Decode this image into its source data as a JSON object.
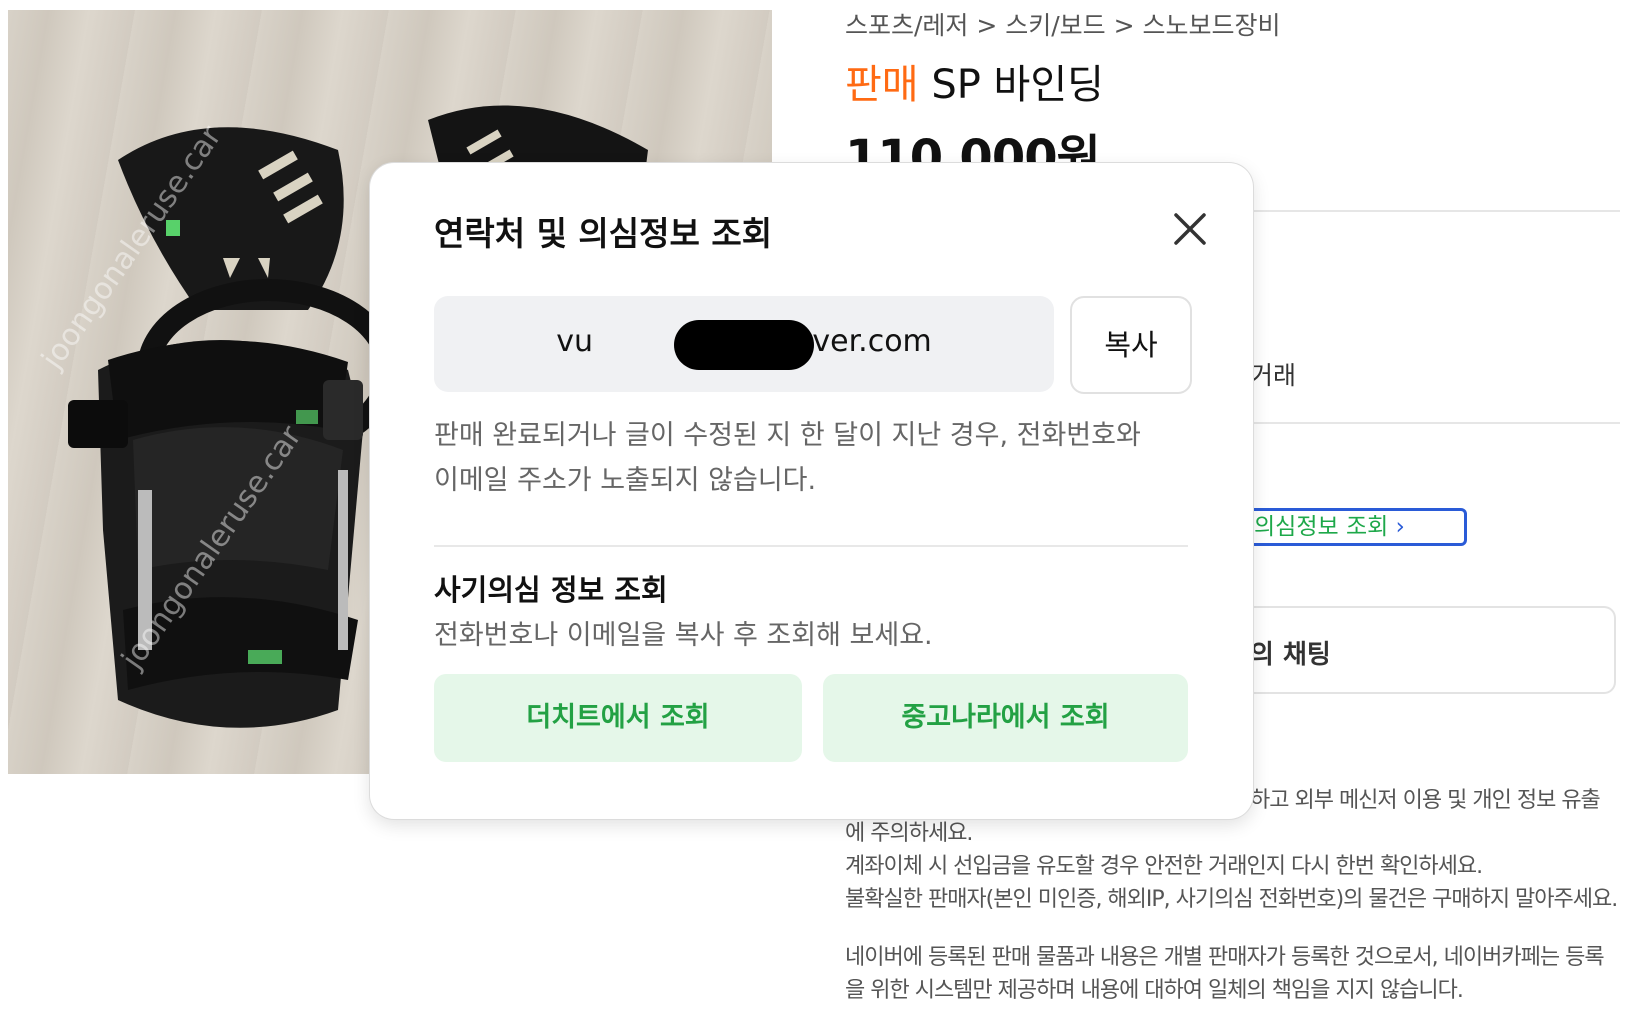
{
  "product": {
    "breadcrumb": "스포츠/레저 > 스키/보드 > 스노보드장비",
    "sale_label": "판매",
    "name": "SP 바인딩",
    "price": "110,000원",
    "trade_text": "거래",
    "fraud_link_label": "의심정보 조회",
    "chat_label": "의 채팅",
    "watermark": "joongonaleruse.car",
    "notices": [
      "하고 외부 메신저 이용 및 개인 정보 유출",
      "에 주의하세요.",
      "계좌이체 시 선입금을 유도할 경우 안전한 거래인지 다시 한번 확인하세요.",
      "불확실한 판매자(본인 미인증, 해외IP, 사기의심 전화번호)의 물건은 구매하지 말아주세요.",
      "네이버에 등록된 판매 물품과 내용은 개별 판매자가 등록한 것으로서, 네이버카페는 등록",
      "을 위한 시스템만 제공하며 내용에 대하여 일체의 책임을 지지 않습니다."
    ]
  },
  "modal": {
    "title": "연락처 및 의심정보 조회",
    "close_icon": "close-icon",
    "email_prefix": "vu",
    "email_suffix": "@naver.com",
    "copy_label": "복사",
    "description": "판매 완료되거나 글이 수정된 지 한 달이 지난 경우, 전화번호와 이메일 주소가 노출되지 않습니다.",
    "section_title": "사기의심 정보 조회",
    "section_desc": "전화번호나 이메일을 복사 후 조회해 보세요.",
    "button_thecheat": "더치트에서 조회",
    "button_joonggonara": "중고나라에서 조회"
  },
  "colors": {
    "sale": "#ff6a13",
    "green_text": "#23a144",
    "green_bg": "#e5f7e9",
    "link_border": "#2a5bd7"
  }
}
